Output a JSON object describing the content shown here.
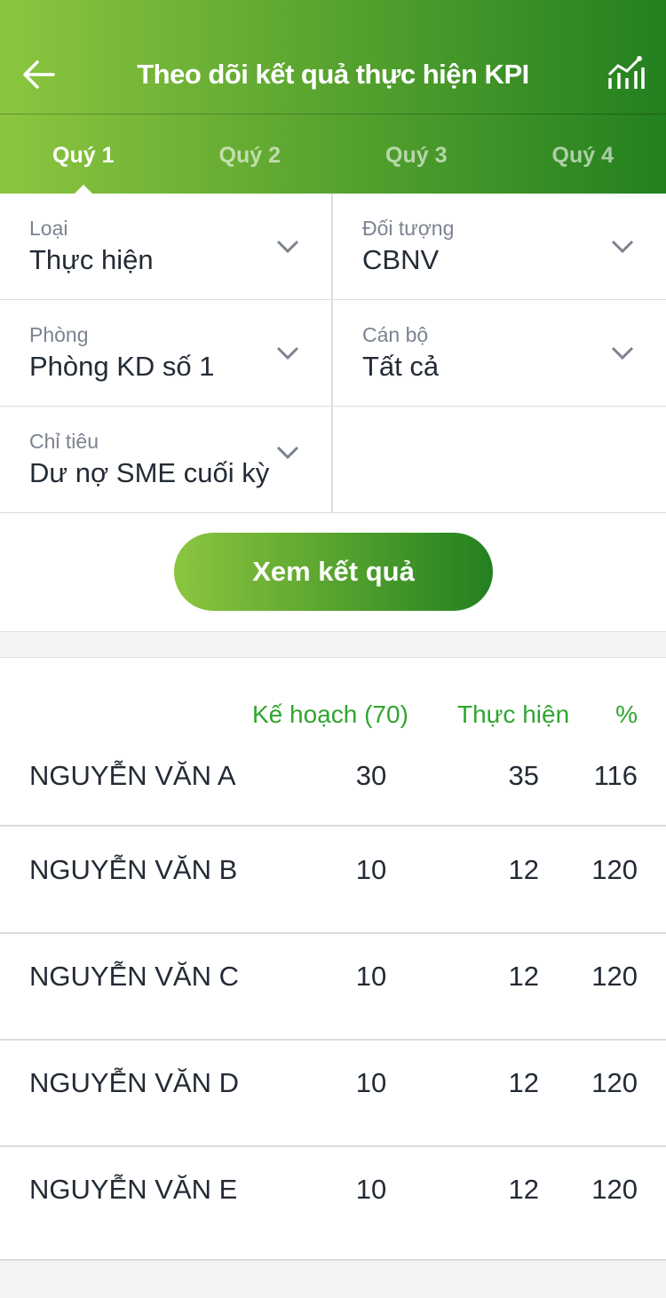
{
  "header": {
    "title": "Theo dõi kết quả thực hiện KPI",
    "back_icon": "arrow-left-icon",
    "chart_icon": "chart-icon"
  },
  "tabs": [
    {
      "label": "Quý 1",
      "active": true
    },
    {
      "label": "Quý 2"
    },
    {
      "label": "Quý 3"
    },
    {
      "label": "Quý 4"
    }
  ],
  "filters": {
    "loai": {
      "label": "Loại",
      "value": "Thực hiện"
    },
    "doi_tuong": {
      "label": "Đối tượng",
      "value": "CBNV"
    },
    "phong": {
      "label": "Phòng",
      "value": "Phòng KD số 1"
    },
    "can_bo": {
      "label": "Cán bộ",
      "value": "Tất cả"
    },
    "chi_tieu": {
      "label": "Chỉ tiêu",
      "value": "Dư nợ SME cuối kỳ"
    }
  },
  "view_button": "Xem kết quả",
  "table": {
    "headers": {
      "plan": "Kế hoạch (70)",
      "actual": "Thực hiện",
      "percent": "%"
    },
    "rows": [
      {
        "name": "NGUYỄN VĂN A",
        "plan": "30",
        "actual": "35",
        "percent": "116"
      },
      {
        "name": "NGUYỄN VĂN B",
        "plan": "10",
        "actual": "12",
        "percent": "120"
      },
      {
        "name": "NGUYỄN VĂN C",
        "plan": "10",
        "actual": "12",
        "percent": "120"
      },
      {
        "name": "NGUYỄN VĂN D",
        "plan": "10",
        "actual": "12",
        "percent": "120"
      },
      {
        "name": "NGUYỄN VĂN E",
        "plan": "10",
        "actual": "12",
        "percent": "120"
      }
    ]
  }
}
